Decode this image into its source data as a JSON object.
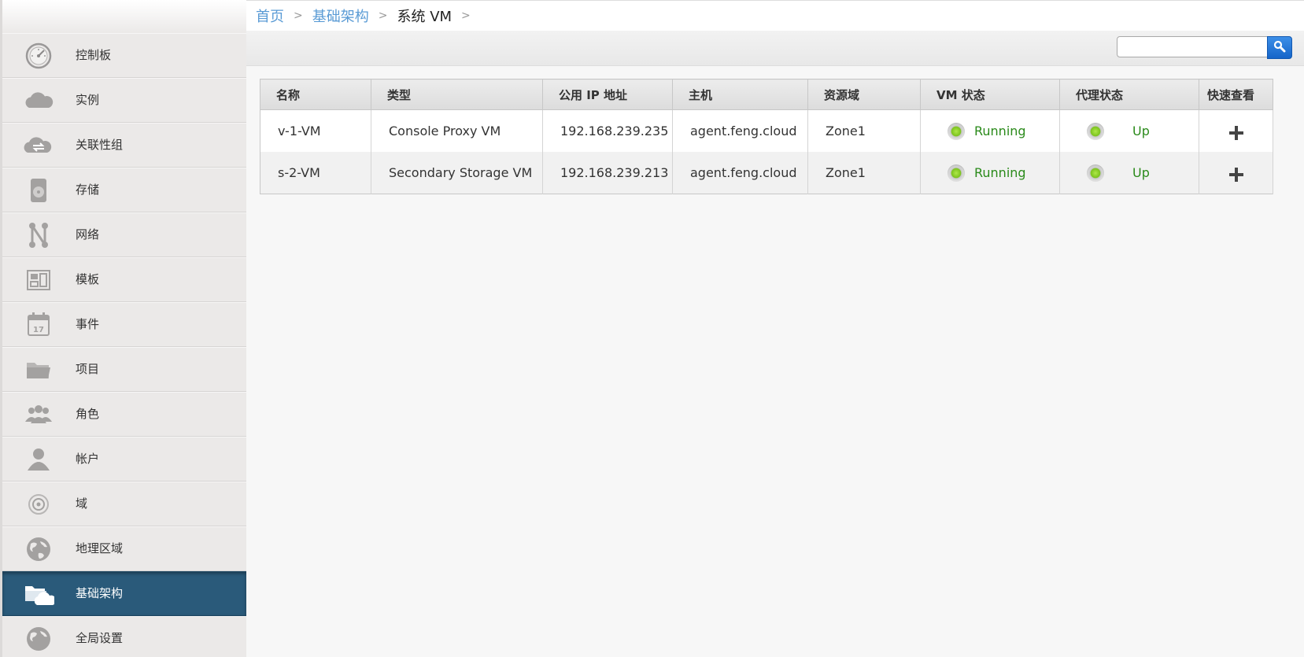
{
  "sidebar": {
    "items": [
      {
        "label": "控制板",
        "icon": "dashboard-gauge-icon"
      },
      {
        "label": "实例",
        "icon": "cloud-icon"
      },
      {
        "label": "关联性组",
        "icon": "cloud-sync-icon"
      },
      {
        "label": "存储",
        "icon": "disk-icon"
      },
      {
        "label": "网络",
        "icon": "network-icon"
      },
      {
        "label": "模板",
        "icon": "template-icon"
      },
      {
        "label": "事件",
        "icon": "calendar-icon"
      },
      {
        "label": "项目",
        "icon": "folder-icon"
      },
      {
        "label": "角色",
        "icon": "roles-icon"
      },
      {
        "label": "帐户",
        "icon": "user-icon"
      },
      {
        "label": "域",
        "icon": "domain-icon"
      },
      {
        "label": "地理区域",
        "icon": "globe-icon"
      },
      {
        "label": "基础架构",
        "icon": "infrastructure-icon",
        "active": true
      },
      {
        "label": "全局设置",
        "icon": "settings-globe-icon"
      }
    ]
  },
  "breadcrumb": {
    "home": "首页",
    "section": "基础架构",
    "current": "系统 VM",
    "sep": ">"
  },
  "search": {
    "placeholder": "",
    "value": ""
  },
  "table": {
    "headers": [
      "名称",
      "类型",
      "公用 IP 地址",
      "主机",
      "资源域",
      "VM 状态",
      "代理状态",
      "快速查看"
    ],
    "rows": [
      {
        "name": "v-1-VM",
        "type": "Console Proxy VM",
        "ip": "192.168.239.235",
        "host": "agent.feng.cloud",
        "zone": "Zone1",
        "vm_state": "Running",
        "agent_state": "Up"
      },
      {
        "name": "s-2-VM",
        "type": "Secondary Storage VM",
        "ip": "192.168.239.213",
        "host": "agent.feng.cloud",
        "zone": "Zone1",
        "vm_state": "Running",
        "agent_state": "Up"
      }
    ]
  },
  "colors": {
    "active_nav": "#2a5a7a",
    "link": "#5a9bd5",
    "status_green": "#2a8a1a",
    "search_button": "#1565c9"
  }
}
